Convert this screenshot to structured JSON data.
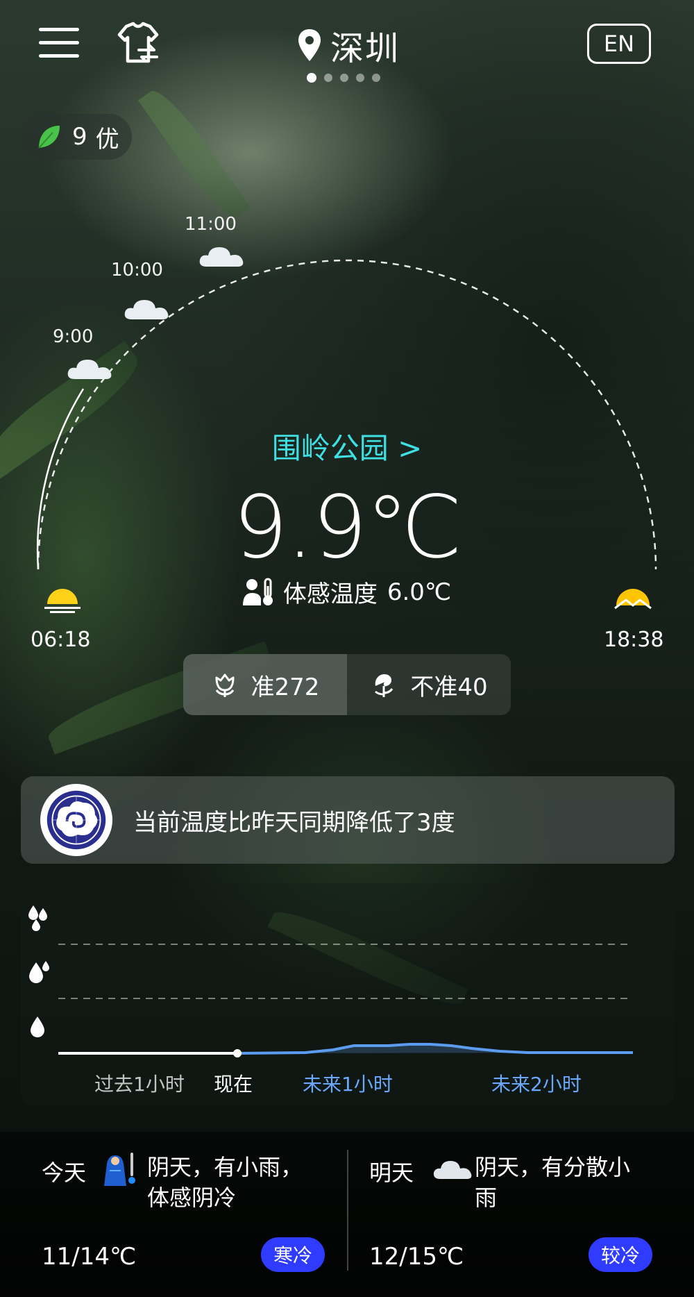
{
  "header": {
    "city": "深圳",
    "language_button": "EN",
    "page_dots": 5,
    "active_dot": 0
  },
  "air_quality": {
    "value": "9",
    "level": "优"
  },
  "hourly": [
    {
      "time": "9:00",
      "icon": "cloud-icon"
    },
    {
      "time": "10:00",
      "icon": "cloud-icon"
    },
    {
      "time": "11:00",
      "icon": "cloud-icon"
    }
  ],
  "current": {
    "station": "围岭公园 >",
    "temperature": "9.9℃",
    "feels_like_label": "体感温度",
    "feels_like_value": "6.0℃"
  },
  "sun": {
    "sunrise": "06:18",
    "sunset": "18:38"
  },
  "vote": {
    "accurate": "准272",
    "inaccurate": "不准40"
  },
  "notice": {
    "text": "当前温度比昨天同期降低了3度"
  },
  "rain_chart": {
    "labels": [
      "过去1小时",
      "现在",
      "未来1小时",
      "未来2小时"
    ],
    "icons": [
      "heavy-rain-drops-icon",
      "moderate-rain-drops-icon",
      "light-rain-drop-icon"
    ]
  },
  "forecast": {
    "today": {
      "label": "今天",
      "desc_line1": "阴天，有小雨，",
      "desc_line2": "体感阴冷",
      "range": "11/14℃",
      "badge": "寒冷"
    },
    "tomorrow": {
      "label": "明天",
      "desc_line1": "阴天，有分散小",
      "desc_line2": "雨",
      "range": "12/15℃",
      "badge": "较冷"
    }
  },
  "colors": {
    "accent_cyan": "#3fe0e3",
    "badge_blue": "#2f3bff",
    "rain_line": "#5b9bf0"
  }
}
